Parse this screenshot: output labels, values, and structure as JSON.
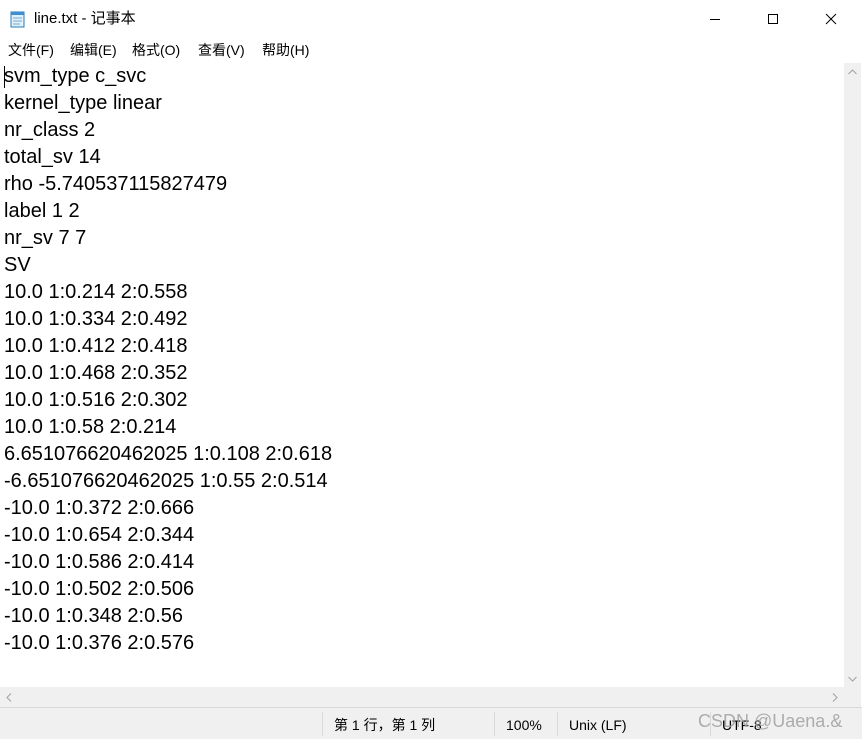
{
  "window": {
    "title": "line.txt - 记事本",
    "icon": "notepad-icon"
  },
  "menu": [
    "文件(F)",
    "编辑(E)",
    "格式(O)",
    "查看(V)",
    "帮助(H)"
  ],
  "editor": {
    "lines": [
      "svm_type c_svc",
      "kernel_type linear",
      "nr_class 2",
      "total_sv 14",
      "rho -5.740537115827479",
      "label 1 2",
      "nr_sv 7 7",
      "SV",
      "10.0 1:0.214 2:0.558",
      "10.0 1:0.334 2:0.492",
      "10.0 1:0.412 2:0.418",
      "10.0 1:0.468 2:0.352",
      "10.0 1:0.516 2:0.302",
      "10.0 1:0.58 2:0.214",
      "6.651076620462025 1:0.108 2:0.618",
      "-6.651076620462025 1:0.55 2:0.514",
      "-10.0 1:0.372 2:0.666",
      "-10.0 1:0.654 2:0.344",
      "-10.0 1:0.586 2:0.414",
      "-10.0 1:0.502 2:0.506",
      "-10.0 1:0.348 2:0.56",
      "-10.0 1:0.376 2:0.576"
    ]
  },
  "status": {
    "position": "第 1 行，第 1 列",
    "zoom": "100%",
    "line_ending": "Unix (LF)",
    "encoding": "UTF-8"
  },
  "watermark": "CSDN @Uaena.&"
}
